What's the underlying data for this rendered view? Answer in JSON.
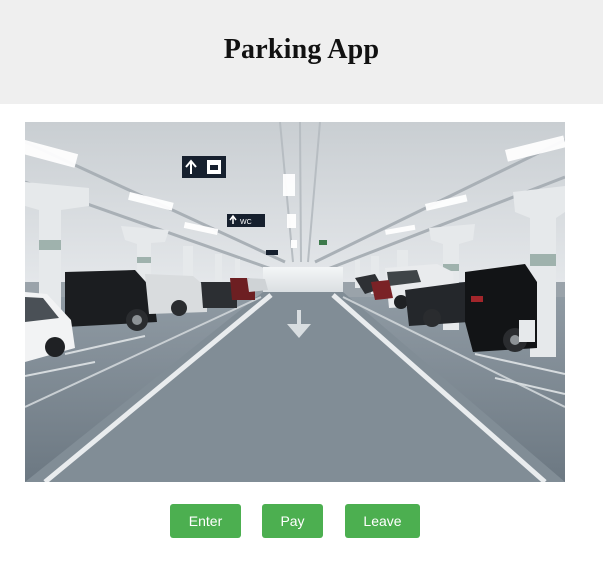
{
  "header": {
    "title": "Parking App"
  },
  "hero_image": {
    "subject": "underground parking garage with parked cars",
    "sign_text": "WC"
  },
  "actions": {
    "enter_label": "Enter",
    "pay_label": "Pay",
    "leave_label": "Leave"
  },
  "colors": {
    "header_bg": "#efefef",
    "button_bg": "#4caf50",
    "button_text": "#ffffff"
  }
}
